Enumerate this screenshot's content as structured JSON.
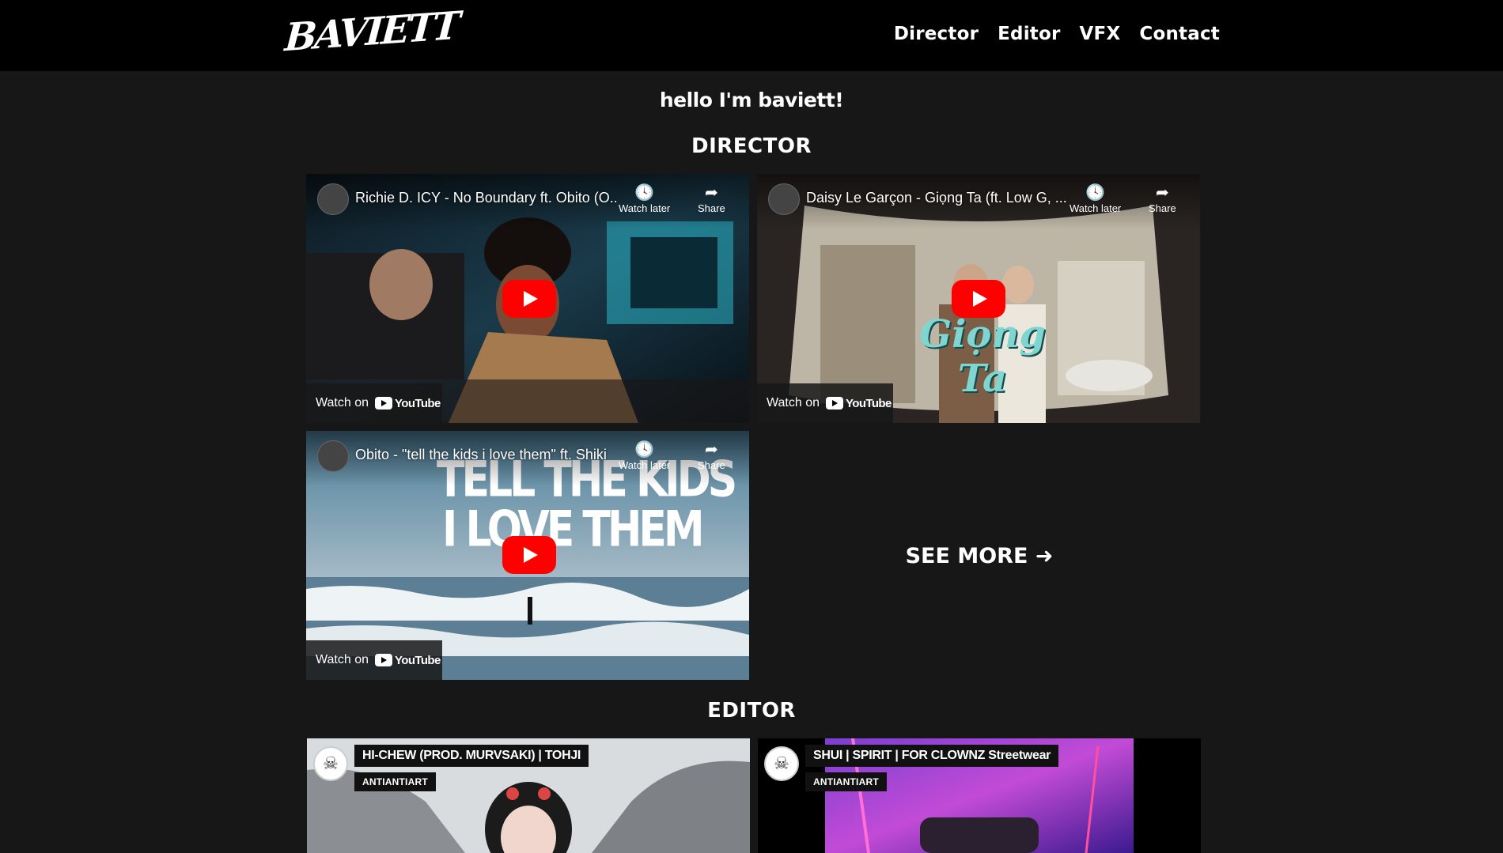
{
  "header": {
    "logo_text": "BAVIETT",
    "nav": [
      "Director",
      "Editor",
      "VFX",
      "Contact"
    ]
  },
  "greeting": "hello I'm baviett!",
  "sections": {
    "director": "DIRECTOR",
    "editor": "EDITOR"
  },
  "video_common": {
    "watch_later": "Watch later",
    "share": "Share",
    "watch_on": "Watch on",
    "youtube": "YouTube"
  },
  "director_videos": [
    {
      "title": "Richie D. ICY - No Boundary ft. Obito (O..."
    },
    {
      "title": "Daisy Le Garçon - Giọng Ta (ft. Low G, ..."
    },
    {
      "title": "Obito - \"tell the kids i love them\" ft. Shiki"
    }
  ],
  "thumb_text": {
    "v3_line1": "TELL THE KIDS",
    "v3_line2": "I LOVE THEM",
    "v2_logo": "Giọng Ta"
  },
  "see_more": "SEE MORE ➜",
  "editor_videos": [
    {
      "title": "HI-CHEW (PROD. MURVSAKI) | TOHJI",
      "channel": "ANTIANTIART"
    },
    {
      "title": "SHUI | SPIRIT | FOR CLOWNZ Streetwear",
      "channel": "ANTIANTIART"
    }
  ]
}
